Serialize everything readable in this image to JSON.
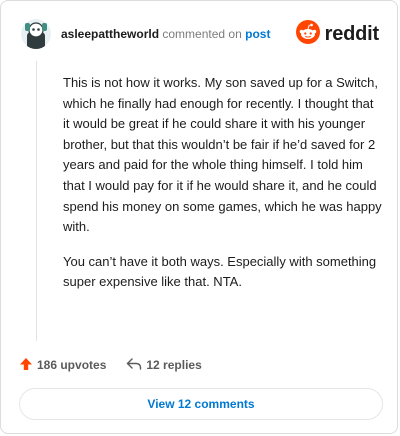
{
  "comment": {
    "author": "asleepattheworld",
    "action_text": "commented on",
    "post_link": "post",
    "paragraphs": [
      "This is not how it works. My son saved up for a Switch, which he finally had enough for recently. I thought that it would be great if he could share it with his younger brother, but that this wouldn’t be fair if he’d saved for 2 years and paid for the whole thing himself. I told him that I would pay for it if he would share it, and he could spend his money on some games, which he was happy with.",
      "You can’t have it both ways. Especially with something super expensive like that. NTA."
    ]
  },
  "brand": {
    "name": "reddit",
    "color": "#ff4500"
  },
  "actions": {
    "upvotes": "186 upvotes",
    "replies": "12 replies"
  },
  "view_button": {
    "label": "View 12 comments"
  },
  "colors": {
    "link": "#0079d3",
    "upvote": "#ff4500",
    "text": "#1c1c1c",
    "muted": "#7c7c7c"
  }
}
